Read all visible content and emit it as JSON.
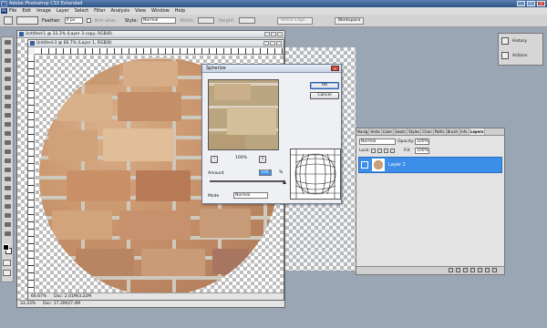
{
  "app": {
    "title": "Adobe Photoshop CS3 Extended",
    "logo": "Ps",
    "window_buttons": [
      "_",
      "□",
      "×"
    ]
  },
  "menu": {
    "items": [
      "File",
      "Edit",
      "Image",
      "Layer",
      "Select",
      "Filter",
      "Analysis",
      "View",
      "Window",
      "Help"
    ]
  },
  "options": {
    "feather_label": "Feather:",
    "feather_value": "0 px",
    "antialias_label": "Anti-alias",
    "style_label": "Style:",
    "style_value": "Normal",
    "width_label": "Width:",
    "height_label": "Height:",
    "refine_edge_label": "Refine Edge...",
    "workspace_label": "Workspace"
  },
  "doc_back": {
    "title": "Untitled-1 @ 33.3% (Layer 3 copy, RGB/8)",
    "zoom": "33.33%",
    "doc_info": "Doc: 17.2M/27.4M"
  },
  "doc_front": {
    "title": "Untitled-3 @ 66.7% (Layer 1, RGB/8)",
    "zoom": "66.67%",
    "doc_info": "Doc: 2.01M/3.22M"
  },
  "spherize": {
    "title": "Spherize",
    "ok_label": "OK",
    "cancel_label": "Cancel",
    "preview_zoom": "100%",
    "minus": "−",
    "plus": "+",
    "amount_label": "Amount",
    "amount_value": "100",
    "amount_unit": "%",
    "amount_fraction": 1.0,
    "mode_label": "Mode",
    "mode_value": "Normal"
  },
  "layers": {
    "tabs": [
      "Navig",
      "Histo",
      "Color",
      "Swatc",
      "Styles",
      "Chan",
      "Paths",
      "Brush",
      "Info",
      "Layers"
    ],
    "blend_mode": "Normal",
    "opacity_label": "Opacity:",
    "opacity_value": "100%",
    "lock_label": "Lock:",
    "fill_label": "Fill:",
    "fill_value": "100%",
    "layer_name": "Layer 1"
  },
  "mini_panels": {
    "history_label": "History",
    "actions_label": "Actions"
  },
  "colors": {
    "accent": "#3d8ee8",
    "title_bar": "#2f5487",
    "layer_selected": "#3d8ee8"
  }
}
